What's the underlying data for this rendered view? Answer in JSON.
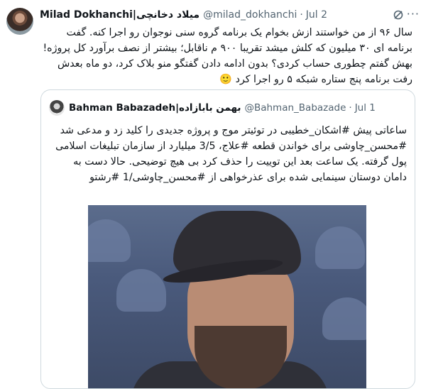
{
  "tweet": {
    "author_name": "Milad Dokhanchi|میلاد دخانچی",
    "handle": "@milad_dokhanchi",
    "separator": "·",
    "date": "Jul 2",
    "more_label": "···",
    "text": "سال ۹۶ از من خواستند ازش بخوام یک برنامه گروه سنی نوجوان رو اجرا کنه. گفت برنامه ای ۳۰ میلیون که کلش میشد تقریبا ۹۰۰ م ناقابل؛ بیشتر از نصف برآورد کل پروژه! بهش گفتم چطوری حساب کردی؟ بدون ادامه دادن گفتگو منو بلاک کرد، دو ماه بعدش رفت برنامه پنج ستاره شبکه ۵ رو اجرا کرد 🙂"
  },
  "quote": {
    "author_name": "Bahman Babazadeh|بهمن بابازاده",
    "handle": "@Bahman_Babazade",
    "separator": "·",
    "date": "Jul 1",
    "text": "ساعاتی پیش #اشکان_خطیبی در توئیتر موج و پروژه جدیدی را کلید زد و مدعی شد #محسن_چاوشی برای خواندن قطعه #علاج، 3/5 میلیارد از سازمان تبلیغات اسلامی پول گرفته. یک ساعت بعد این توییت را حذف کرد بی هیچ توضیحی. حالا دست به دامان دوستان سینمایی شده برای عذرخواهی از #محسن_چاوشی/1 #رشتو"
  },
  "icons": {
    "grok": "grok-icon",
    "more": "more-options-icon"
  },
  "colors": {
    "text": "#0f1419",
    "secondary": "#536471",
    "border": "#cfd9de"
  }
}
